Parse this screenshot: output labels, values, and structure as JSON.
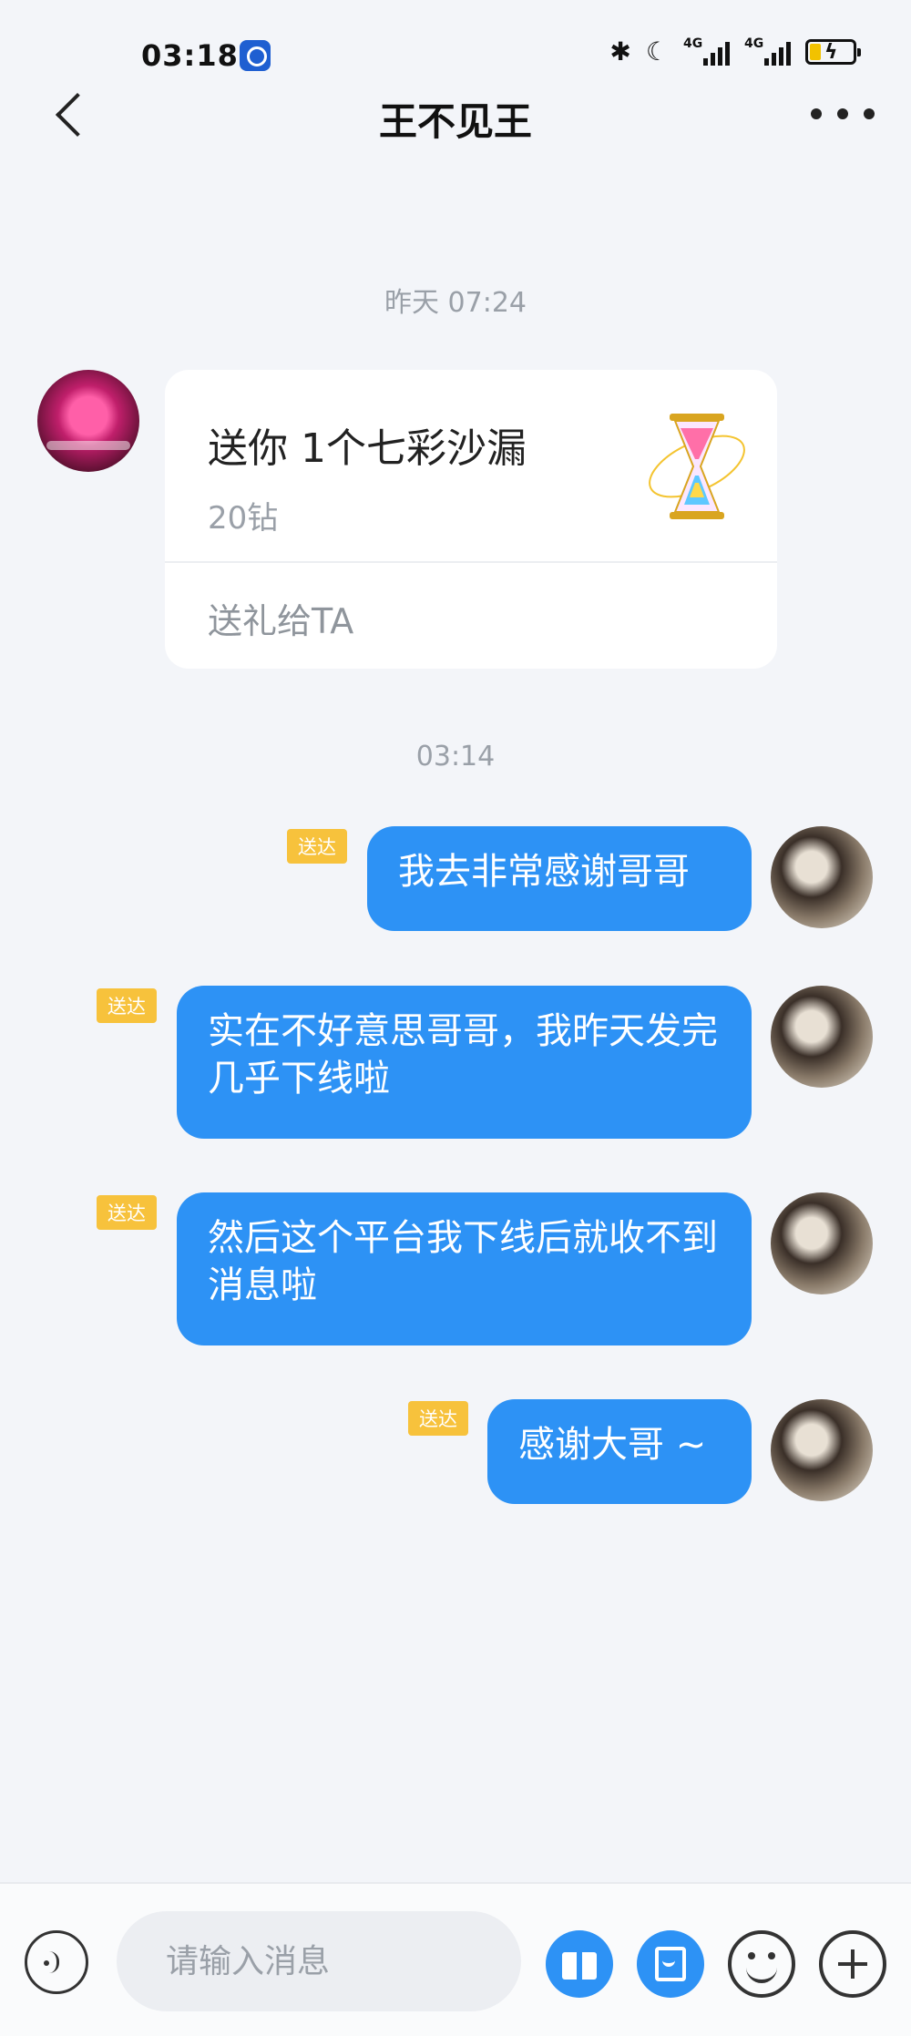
{
  "status_bar": {
    "time": "03:18",
    "network_1": "4G",
    "network_2": "4G"
  },
  "header": {
    "title": "王不见王"
  },
  "timestamps": [
    "昨天 07:24",
    "03:14"
  ],
  "gift_card": {
    "title": "送你 1个七彩沙漏",
    "price": "20钻",
    "action": "送礼给TA"
  },
  "messages": [
    {
      "text": "我去非常感谢哥哥",
      "status": "送达"
    },
    {
      "text": "实在不好意思哥哥，我昨天发完几乎下线啦",
      "status": "送达"
    },
    {
      "text": "然后这个平台我下线后就收不到消息啦",
      "status": "送达"
    },
    {
      "text": "感谢大哥 ~",
      "status": "送达"
    }
  ],
  "input": {
    "placeholder": "请输入消息"
  },
  "icons": {
    "back": "chevron-left-icon",
    "more": "more-icon",
    "voice": "voice-icon",
    "gift": "gift-icon",
    "red_packet": "red-packet-icon",
    "emoji": "emoji-icon",
    "plus": "plus-icon"
  },
  "colors": {
    "bubble": "#2d92f5",
    "badge": "#f7c23c",
    "background": "#f3f5f9"
  }
}
